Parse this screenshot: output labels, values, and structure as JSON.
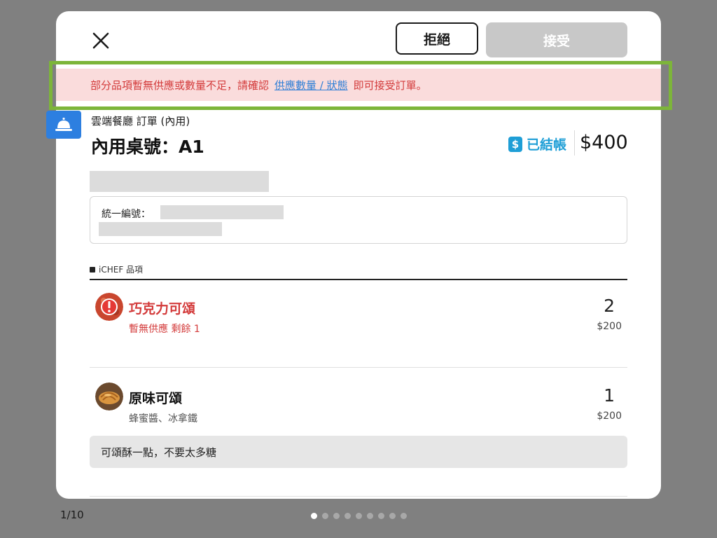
{
  "header": {
    "reject_label": "拒絕",
    "accept_label": "接受"
  },
  "warning": {
    "prefix": "部分品項暫無供應或數量不足，請確認",
    "link_text": "供應數量 / 狀態",
    "suffix": "即可接受訂單。"
  },
  "order": {
    "type_label": "雲端餐廳 訂單 (內用)",
    "table_label": "內用桌號：A1",
    "paid_label": "已結帳",
    "paid_icon": "dollar-icon",
    "total": "$400"
  },
  "tax": {
    "label": "統一編號："
  },
  "section": {
    "title": "iCHEF 品項"
  },
  "items": [
    {
      "name": "巧克力可頌",
      "sub": "暫無供應 剩餘 1",
      "qty": "2",
      "price": "$200",
      "unavailable": true
    },
    {
      "name": "原味可頌",
      "sub": "蜂蜜醬、冰拿鐵",
      "qty": "1",
      "price": "$200",
      "unavailable": false
    }
  ],
  "note": "可頌酥一點，不要太多糖",
  "pager": {
    "label": "1/10",
    "total_pages": 10,
    "current_page": 1
  },
  "colors": {
    "accent_blue": "#2f7fd6",
    "warning_red": "#d33a3a",
    "paid_blue": "#1e9ed6",
    "highlight_green": "#7db53a"
  }
}
